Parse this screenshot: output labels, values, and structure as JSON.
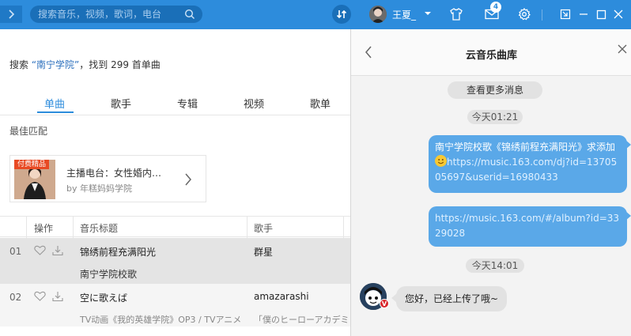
{
  "topbar": {
    "search_placeholder": "搜索音乐，视频，歌词，电台",
    "user_name": "王夏_",
    "mail_count": "4",
    "icons": [
      "nav-back-icon",
      "search-icon",
      "sync-icon",
      "chevron-down-icon",
      "tshirt-icon",
      "mail-icon",
      "gear-icon",
      "mini-mode-icon",
      "minimize-icon",
      "maximize-icon",
      "close-icon"
    ],
    "accent": "#2d8cdc"
  },
  "search": {
    "prefix": "搜索 ",
    "keyword": "“南宁学院”",
    "suffix": "，找到 299 首单曲"
  },
  "tabs": [
    {
      "label": "单曲",
      "active": true
    },
    {
      "label": "歌手"
    },
    {
      "label": "专辑"
    },
    {
      "label": "视频"
    },
    {
      "label": "歌单"
    }
  ],
  "best_match": {
    "heading": "最佳匹配",
    "badge": "付费精品",
    "title": "主播电台：女性婚内…",
    "by_prefix": "by ",
    "by_author": "年糕妈妈学院"
  },
  "table": {
    "headers": {
      "actions": "操作",
      "title": "音乐标题",
      "artist": "歌手"
    },
    "rows": [
      {
        "index": "01",
        "title": "锦绣前程充满阳光",
        "artist": "群星",
        "alias": "南宁学院校歌",
        "alias_artist": ""
      },
      {
        "index": "02",
        "title": "空に歌えば",
        "artist": "amazarashi",
        "alias": "TV动画《我的英雄学院》OP3 / TVアニメ",
        "alias_artist": "「僕のヒーローアカデミ"
      }
    ]
  },
  "messages": {
    "title": "云音乐曲库",
    "more_button": "查看更多消息",
    "time1": "今天01:21",
    "bubble1_text": "南宁学院校歌《锦绣前程充满阳光》求添加",
    "bubble1_link": "https://music.163.com/dj?id=1370505697&userid=16980433",
    "bubble2_link": "https://music.163.com/#/album?id=3329028",
    "time2": "今天14:01",
    "vip_badge": "V",
    "reply": "您好，已经上传了哦~",
    "bubble_color": "#5aa8e8"
  }
}
